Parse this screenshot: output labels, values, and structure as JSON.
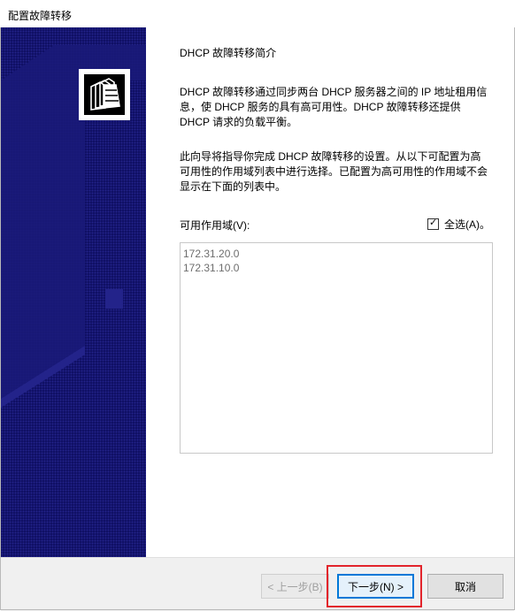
{
  "window": {
    "title": "配置故障转移"
  },
  "sidebar": {
    "icon": "folder-stack-icon",
    "colors": {
      "background": "#0b0b5c",
      "shapes": "#1f1f7c"
    }
  },
  "main": {
    "heading": "DHCP 故障转移简介",
    "paragraph1_lines": [
      "DHCP 故障转移通过同步两台 DHCP 服务器之间的 IP 地址租用信",
      "息，使 DHCP 服务的具有高可用性。DHCP 故障转移还提供",
      "DHCP 请求的负载平衡。"
    ],
    "paragraph2_lines": [
      "此向导将指导你完成 DHCP 故障转移的设置。从以下可配置为高",
      "可用性的作用域列表中进行选择。已配置为高可用性的作用域不会",
      "显示在下面的列表中。"
    ],
    "scopes_label": "可用作用域(V):",
    "select_all_label": "全选(A)。",
    "select_all_checked": true,
    "scopes": [
      "172.31.20.0",
      "172.31.10.0"
    ]
  },
  "footer": {
    "back_label": "< 上一步(B)",
    "next_label": "下一步(N) >",
    "cancel_label": "取消",
    "highlight_color": "#e2242b"
  }
}
